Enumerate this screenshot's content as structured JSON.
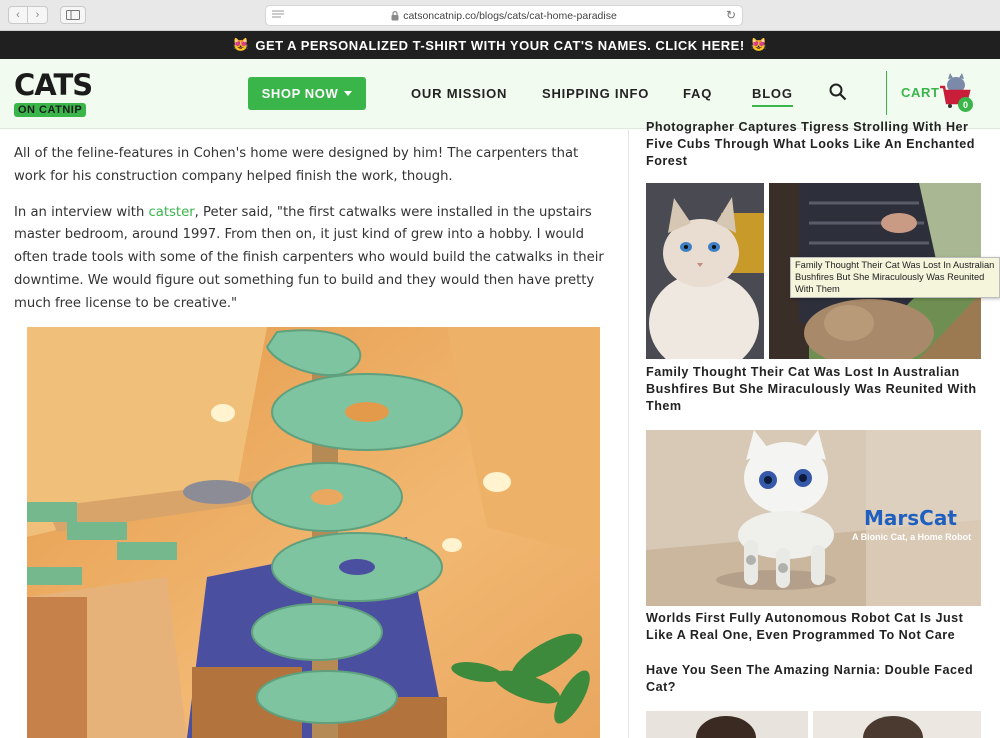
{
  "browser": {
    "url": "catsoncatnip.co/blogs/cats/cat-home-paradise",
    "back_glyph": "‹",
    "forward_glyph": "›",
    "reload_glyph": "↻"
  },
  "promo": {
    "text": "GET A PERSONALIZED T-SHIRT WITH YOUR CAT'S NAMES. CLICK HERE!",
    "emoji": "😻"
  },
  "header": {
    "logo_top": "CATS",
    "logo_bottom": "ON CATNIP",
    "shop_label": "SHOP NOW",
    "nav": {
      "mission": "OUR MISSION",
      "shipping": "SHIPPING INFO",
      "faq": "FAQ",
      "blog": "BLOG"
    },
    "cart_label": "CART",
    "cart_count": "0",
    "brand_color": "#3ab54a"
  },
  "article": {
    "p1": "All of the feline-features in Cohen's home were designed by him! The carpenters that work for his construction company helped finish the work, though.",
    "p2_before": "In an interview with ",
    "p2_link": "catster",
    "p2_after": ", Peter said, \"the first catwalks were installed in the upstairs master bedroom, around 1997. From then on, it just kind of grew into a hobby. I would often trade tools with some of the finish carpenters who would build the catwalks in their downtime. We would figure out something fun to build and they would then have pretty much free license to be creative.\""
  },
  "sidebar": {
    "item0_title": "Photographer Captures Tigress Strolling With Her Five Cubs Through What Looks Like An Enchanted Forest",
    "item1_title": "Family Thought Their Cat Was Lost In Australian Bushfires But She Miraculously Was Reunited With Them",
    "item1_tooltip": "Family Thought Their Cat Was Lost In Australian Bushfires But She Miraculously Was Reunited With Them",
    "item2_brand": "MarsCat",
    "item2_tagline": "A Bionic Cat, a Home Robot",
    "item2_title": "Worlds First Fully Autonomous Robot Cat Is Just Like A Real One, Even Programmed To Not Care",
    "item3_title": "Have You Seen The Amazing Narnia: Double Faced Cat?"
  }
}
